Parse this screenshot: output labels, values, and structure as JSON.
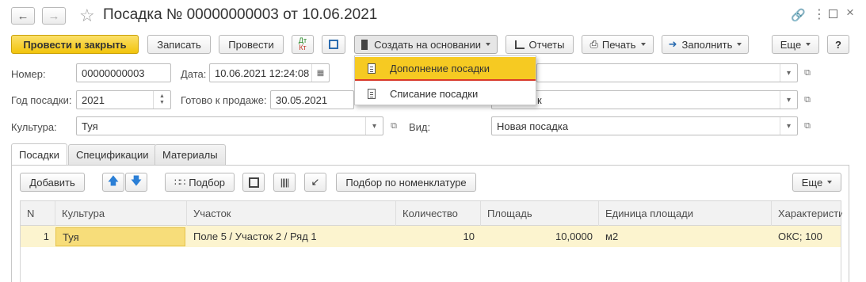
{
  "window": {
    "title": "Посадка № 00000000003 от 10.06.2021"
  },
  "toolbar": {
    "post_close": "Провести и закрыть",
    "save": "Записать",
    "post": "Провести",
    "dt_kt_top": "Дт",
    "dt_kt_bottom": "Кт",
    "create_based": "Создать на основании",
    "reports": "Отчеты",
    "print": "Печать",
    "fill": "Заполнить",
    "more": "Еще",
    "help": "?"
  },
  "dropdown_menu": {
    "items": [
      "Дополнение посадки",
      "Списание посадки"
    ]
  },
  "form": {
    "number_label": "Номер:",
    "number_value": "00000000003",
    "date_label": "Дата:",
    "date_value": "10.06.2021 12:24:08",
    "year_label": "Год посадки:",
    "year_value": "2021",
    "ready_label": "Готово к продаже:",
    "ready_value": "30.05.2021",
    "field2_partial": "к",
    "culture_label": "Культура:",
    "culture_value": "Туя",
    "kind_label": "Вид:",
    "kind_value": "Новая посадка"
  },
  "tabs": [
    "Посадки",
    "Спецификации",
    "Материалы"
  ],
  "table_toolbar": {
    "add": "Добавить",
    "pick": "Подбор",
    "pick_nomenclature": "Подбор по номенклатуре",
    "more": "Еще"
  },
  "table": {
    "columns": [
      "N",
      "Культура",
      "Участок",
      "Количество",
      "Площадь",
      "Единица площади",
      "Характеристи"
    ],
    "rows": [
      [
        "1",
        "Туя",
        "Поле 5 / Участок 2 / Ряд 1",
        "10",
        "10,0000",
        "м2",
        "ОКС; 100"
      ]
    ]
  },
  "colors": {
    "accent_yellow": "#f2c40c",
    "menu_highlight": "#f6ca22",
    "row_highlight": "#fcf4cf",
    "underline_red": "#d83a2c"
  }
}
